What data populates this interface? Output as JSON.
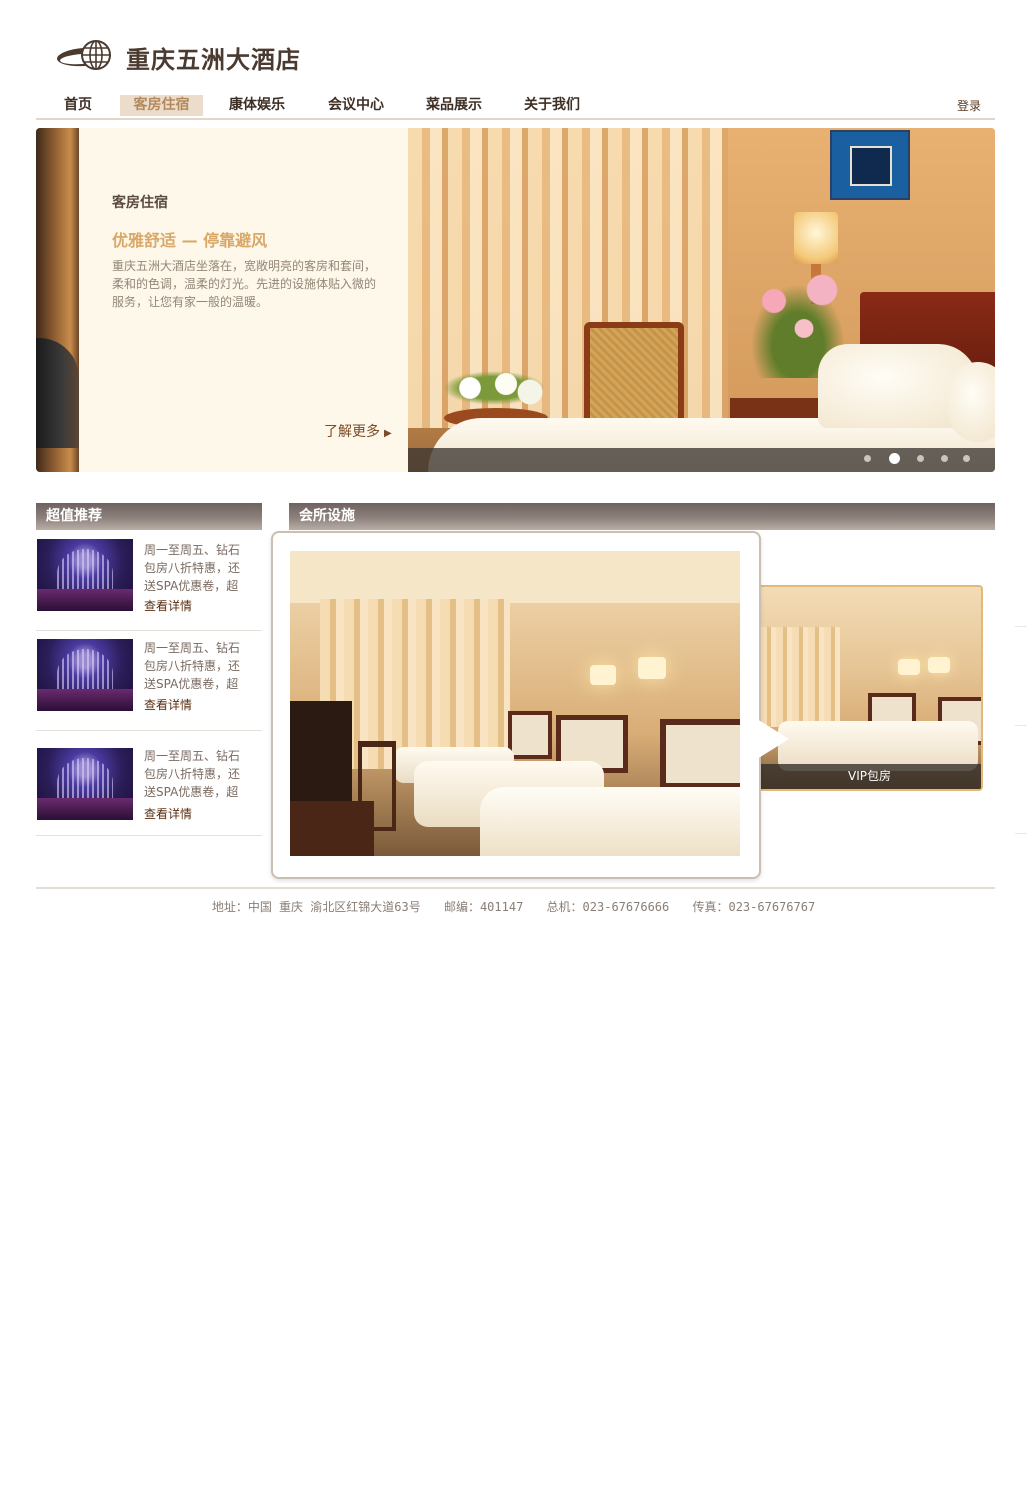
{
  "header": {
    "brand": "重庆五洲大酒店",
    "logo_icon": "globe-swoosh-icon"
  },
  "nav": {
    "items": [
      {
        "label": "首页"
      },
      {
        "label": "客房住宿"
      },
      {
        "label": "康体娱乐"
      },
      {
        "label": "会议中心"
      },
      {
        "label": "菜品展示"
      },
      {
        "label": "关于我们"
      }
    ],
    "active_index": 1,
    "login": "登录"
  },
  "banner": {
    "category": "客房住宿",
    "headline": "优雅舒适 — 停靠避风",
    "description": "重庆五洲大酒店坐落在，宽敞明亮的客房和套间，柔和的色调，温柔的灯光。先进的设施体贴入微的服务，让您有家一般的温暖。",
    "more": "了解更多",
    "slide_count": 5,
    "active_slide": 1
  },
  "recommend": {
    "title": "超值推荐",
    "items": [
      {
        "text": "周一至周五、钻石包房八折特惠，还送SPA优惠卷，超",
        "link": "查看详情"
      },
      {
        "text": "周一至周五、钻石包房八折特惠，还送SPA优惠卷，超",
        "link": "查看详情"
      },
      {
        "text": "周一至周五、钻石包房八折特惠，还送SPA优惠卷，超",
        "link": "查看详情"
      }
    ]
  },
  "facilities": {
    "title": "会所设施",
    "side_caption": "VIP包房"
  },
  "footer": {
    "address": "地址：中国 重庆 渝北区红锦大道63号",
    "postcode": "邮编：401147",
    "phone": "总机：023-67676666",
    "fax": "传真：023-67676767"
  },
  "colors": {
    "accent": "#d9a868",
    "nav_active_bg": "#ecdccc",
    "brand_text": "#4a3a30"
  }
}
